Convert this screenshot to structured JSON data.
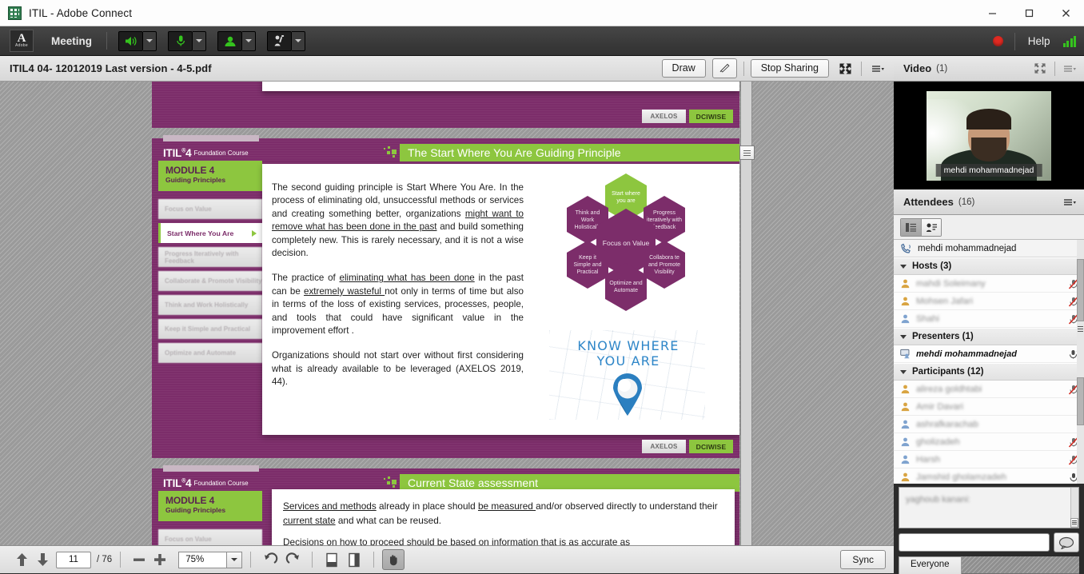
{
  "window": {
    "title": "ITIL - Adobe Connect",
    "app_icon": "excel-like-icon",
    "minimize": "minimize-icon",
    "maximize": "maximize-icon",
    "close": "close-icon"
  },
  "menubar": {
    "logo_letter": "A",
    "logo_sub": "Adobe",
    "meeting_label": "Meeting",
    "speaker_icon": "speaker-icon",
    "mic_icon": "microphone-icon",
    "camera_icon": "webcam-icon",
    "raise_hand_icon": "raise-hand-icon",
    "record_indicator": "recording-dot",
    "help_label": "Help",
    "connection_icon": "connection-strength-icon",
    "accent_green": "#35c31e",
    "record_red": "#e02a22"
  },
  "share_pod": {
    "title": "ITIL4 04- 12012019 Last version - 4-5.pdf",
    "draw_label": "Draw",
    "pointer_icon": "pointer-arrow-icon",
    "stop_sharing_label": "Stop Sharing",
    "fullscreen_icon": "fullscreen-icon",
    "menu_icon": "pod-menu-icon"
  },
  "slides": {
    "partial_top": {
      "logos": [
        "AXELOS",
        "DCIWISE"
      ]
    },
    "main": {
      "brand": "ITIL",
      "brand_sup": "®",
      "brand_num": "4",
      "brand_sub": "Foundation Course",
      "module_title": "MODULE 4",
      "module_sub": "Guiding Principles",
      "nav_items": [
        {
          "label": "Focus on Value",
          "active": false
        },
        {
          "label": "Start Where You Are",
          "active": true
        },
        {
          "label": "Progress Iteratively with Feedback",
          "active": false
        },
        {
          "label": "Collaborate & Promote Visibility",
          "active": false
        },
        {
          "label": "Think and Work Holistically",
          "active": false
        },
        {
          "label": "Keep it Simple and Practical",
          "active": false
        },
        {
          "label": "Optimize and Automate",
          "active": false
        }
      ],
      "title": "The Start Where You Are Guiding Principle",
      "paragraphs": [
        "The second guiding principle is Start Where You Are. In the process of eliminating old, unsuccessful methods or services and creating something better, organizations might want to remove what has been done in the past and build something completely new. This is rarely necessary, and it is not a wise decision.",
        "The practice of eliminating what has been done in the past can be extremely wasteful not only in terms of time but also in terms of the loss of existing services, processes, people, and tools that could have significant value in the improvement effort .",
        "Organizations should not start over without first considering what is already available to be leveraged (AXELOS 2019, 44)."
      ],
      "hexagons": [
        {
          "label": "Start where you are",
          "highlight": true
        },
        {
          "label": "Think and Work Holistically",
          "highlight": false
        },
        {
          "label": "Progress iteratively with feedback",
          "highlight": false
        },
        {
          "label": "Focus on Value",
          "highlight": false
        },
        {
          "label": "Keep it Simple and Practical",
          "highlight": false
        },
        {
          "label": "Collabora te and Promote Visibility",
          "highlight": false
        },
        {
          "label": "Optimize and Automate",
          "highlight": false
        }
      ],
      "image_caption_line1": "KNOW WHERE",
      "image_caption_line2": "YOU ARE",
      "map_pin_icon": "map-pin-icon",
      "logos": [
        "AXELOS",
        "DCIWISE"
      ]
    },
    "bottom": {
      "brand": "ITIL",
      "brand_sup": "®",
      "brand_num": "4",
      "brand_sub": "Foundation Course",
      "module_title": "MODULE 4",
      "module_sub": "Guiding Principles",
      "nav_first": "Focus on Value",
      "title": "Current State assessment",
      "paragraphs": [
        "Services and methods already in place should be measured and/or observed directly to understand their current state and what can be reused.",
        "Decisions on how to proceed should be based on information that is as accurate as"
      ]
    }
  },
  "video_pod": {
    "title": "Video",
    "count": "(1)",
    "fullscreen_icon": "fullscreen-icon",
    "menu_icon": "pod-menu-icon",
    "participant_name": "mehdi mohammadnejad"
  },
  "attendees_pod": {
    "title": "Attendees",
    "count": "(16)",
    "menu_icon": "pod-menu-icon",
    "view_list_icon": "list-view-icon",
    "view_card_icon": "card-view-icon",
    "self_name": "mehdi mohammadnejad",
    "self_icon": "phone-audio-icon",
    "groups": [
      {
        "label": "Hosts (3)",
        "members": [
          {
            "name": "mahdi Soleimany",
            "blurred": true,
            "role_icon": "host-icon",
            "status_icon": "mic-muted-icon"
          },
          {
            "name": "Mohsen Jafari",
            "blurred": true,
            "role_icon": "host-icon",
            "status_icon": "mic-muted-icon"
          },
          {
            "name": "Shahi",
            "blurred": true,
            "role_icon": "host-icon",
            "status_icon": "mic-muted-icon"
          }
        ]
      },
      {
        "label": "Presenters (1)",
        "members": [
          {
            "name": "mehdi mohammadnejad",
            "blurred": false,
            "role_icon": "presenter-screen-icon",
            "status_icon": "mic-active-icon"
          }
        ]
      },
      {
        "label": "Participants (12)",
        "members": [
          {
            "name": "alireza goldhtabi",
            "blurred": true,
            "role_icon": "participant-icon",
            "status_icon": "mic-muted-icon"
          },
          {
            "name": "Amir Davari",
            "blurred": true,
            "role_icon": "participant-icon",
            "status_icon": ""
          },
          {
            "name": "ashrafkarachab",
            "blurred": true,
            "role_icon": "participant-icon",
            "status_icon": ""
          },
          {
            "name": "gholizadeh",
            "blurred": true,
            "role_icon": "participant-icon",
            "status_icon": "mic-muted-icon"
          },
          {
            "name": "Harsh",
            "blurred": true,
            "role_icon": "participant-icon",
            "status_icon": "mic-muted-icon"
          },
          {
            "name": "Jamshid gholamzadeh",
            "blurred": true,
            "role_icon": "participant-icon",
            "status_icon": "mic-icon"
          }
        ]
      }
    ]
  },
  "chat_pod": {
    "message": "yaghoub kanani:",
    "input_placeholder": "",
    "input_value": "",
    "send_icon": "chat-bubble-icon",
    "tab_label": "Everyone"
  },
  "pdf_toolbar": {
    "prev_icon": "arrow-up-icon",
    "next_icon": "arrow-down-icon",
    "page_current": "11",
    "page_total": "/ 76",
    "zoom_out_icon": "minus-icon",
    "zoom_in_icon": "plus-icon",
    "zoom_value": "75%",
    "zoom_caret_icon": "chevron-down-icon",
    "rotate_ccw_icon": "rotate-left-icon",
    "rotate_cw_icon": "rotate-right-icon",
    "page_fit_icon": "fit-page-icon",
    "page_width_icon": "fit-width-icon",
    "pan_icon": "hand-pan-icon",
    "sync_label": "Sync"
  }
}
